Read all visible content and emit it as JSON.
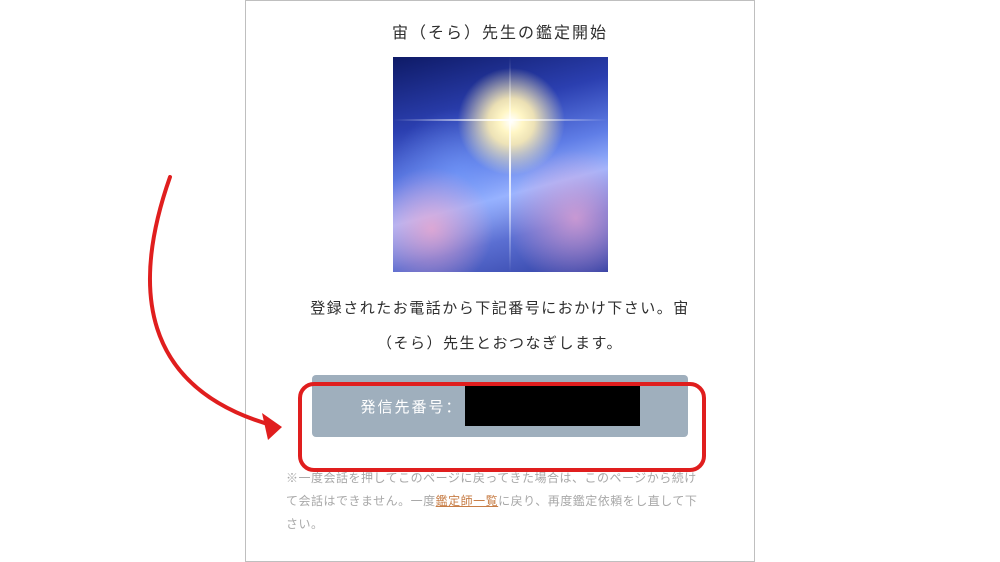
{
  "card": {
    "title": "宙（そら）先生の鑑定開始",
    "instruction_line1": "登録されたお電話から下記番号におかけ下さい。宙",
    "instruction_line2": "（そら）先生とおつなぎします。",
    "phone_label": "発信先番号：",
    "phone_value_redacted": "",
    "note_prefix": "※一度会話を押してこのページに戻ってきた場合は、このページから続けて会話はできません。一度",
    "note_link": "鑑定師一覧",
    "note_suffix": "に戻り、再度鑑定依頼をし直して下さい。"
  }
}
